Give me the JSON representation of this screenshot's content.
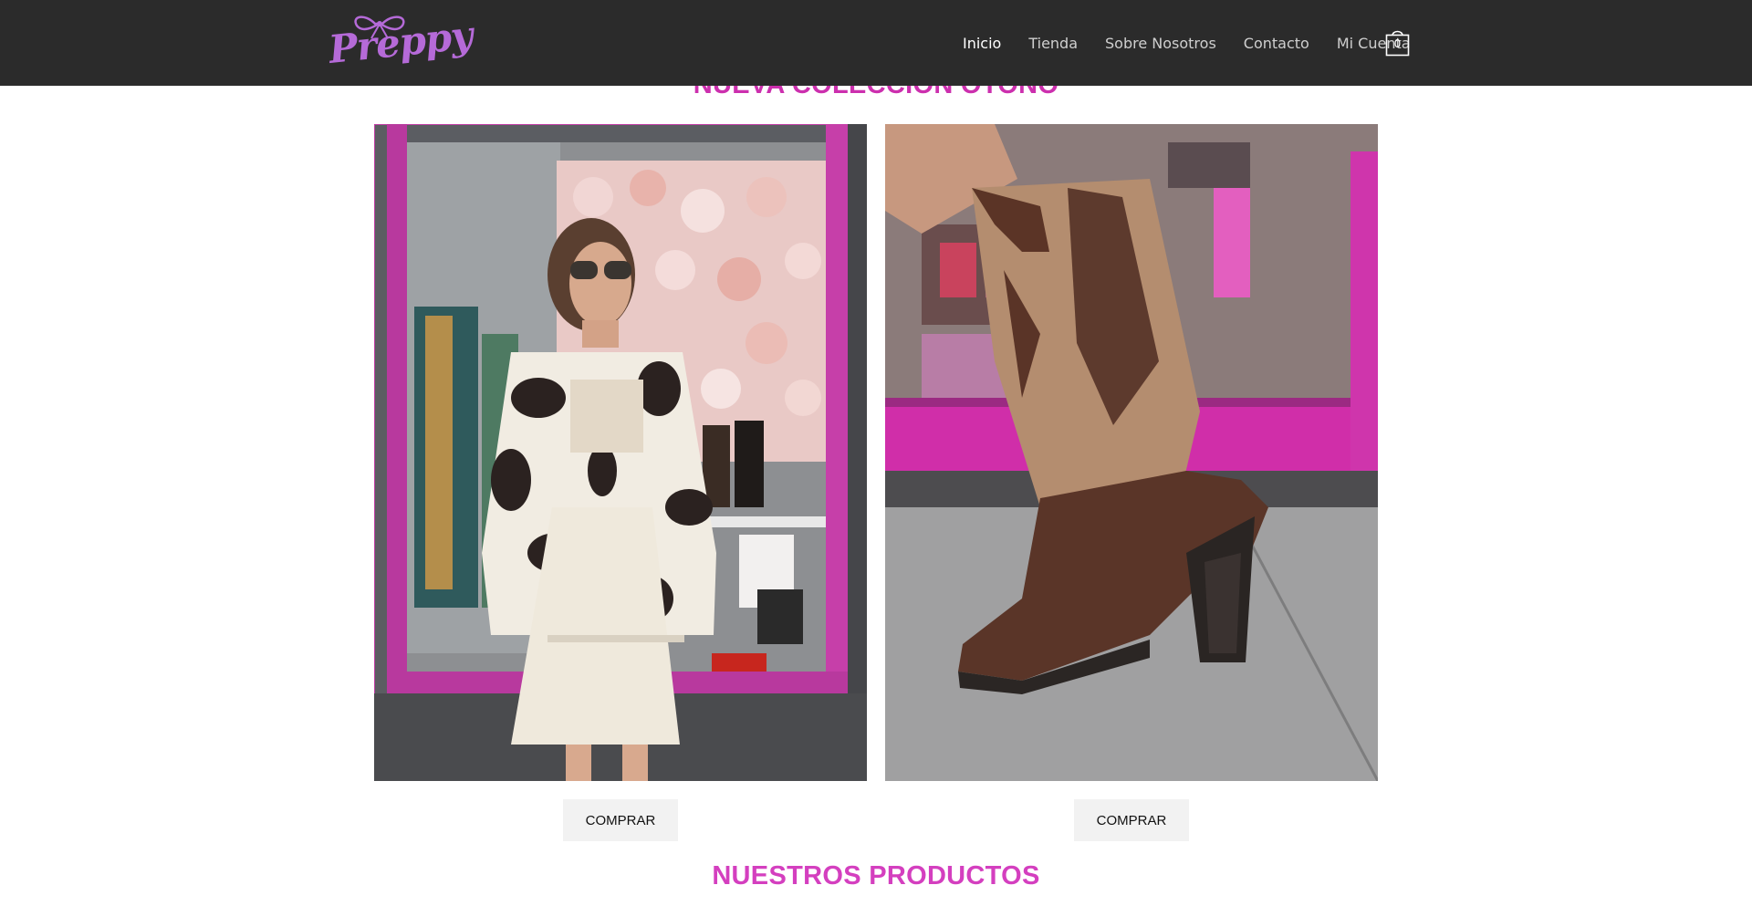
{
  "brand": {
    "logo_text": "Preppy",
    "logo_color": "#b56ad8"
  },
  "nav": {
    "items": [
      {
        "label": "Inicio",
        "active": true
      },
      {
        "label": "Tienda",
        "active": false
      },
      {
        "label": "Sobre Nosotros",
        "active": false
      },
      {
        "label": "Contacto",
        "active": false
      },
      {
        "label": "Mi Cuenta",
        "active": false
      }
    ],
    "cart_icon": "shopping-bag-icon",
    "cart_count": "0"
  },
  "hero": {
    "title": "NUEVA COLECCIÓN OTOÑO",
    "title_color": "#cc2fae",
    "products": [
      {
        "image": "woman-cow-print-jacket-photo",
        "button_label": "COMPRAR"
      },
      {
        "image": "brown-cowboy-boot-photo",
        "button_label": "COMPRAR"
      }
    ]
  },
  "products_section": {
    "title": "NUESTROS PRODUCTOS",
    "title_color": "#d43fbf"
  },
  "colors": {
    "header_bg": "#2b2b2b",
    "nav_text": "#cfcfcf",
    "nav_active": "#ffffff",
    "button_bg": "#f2f2f2"
  }
}
